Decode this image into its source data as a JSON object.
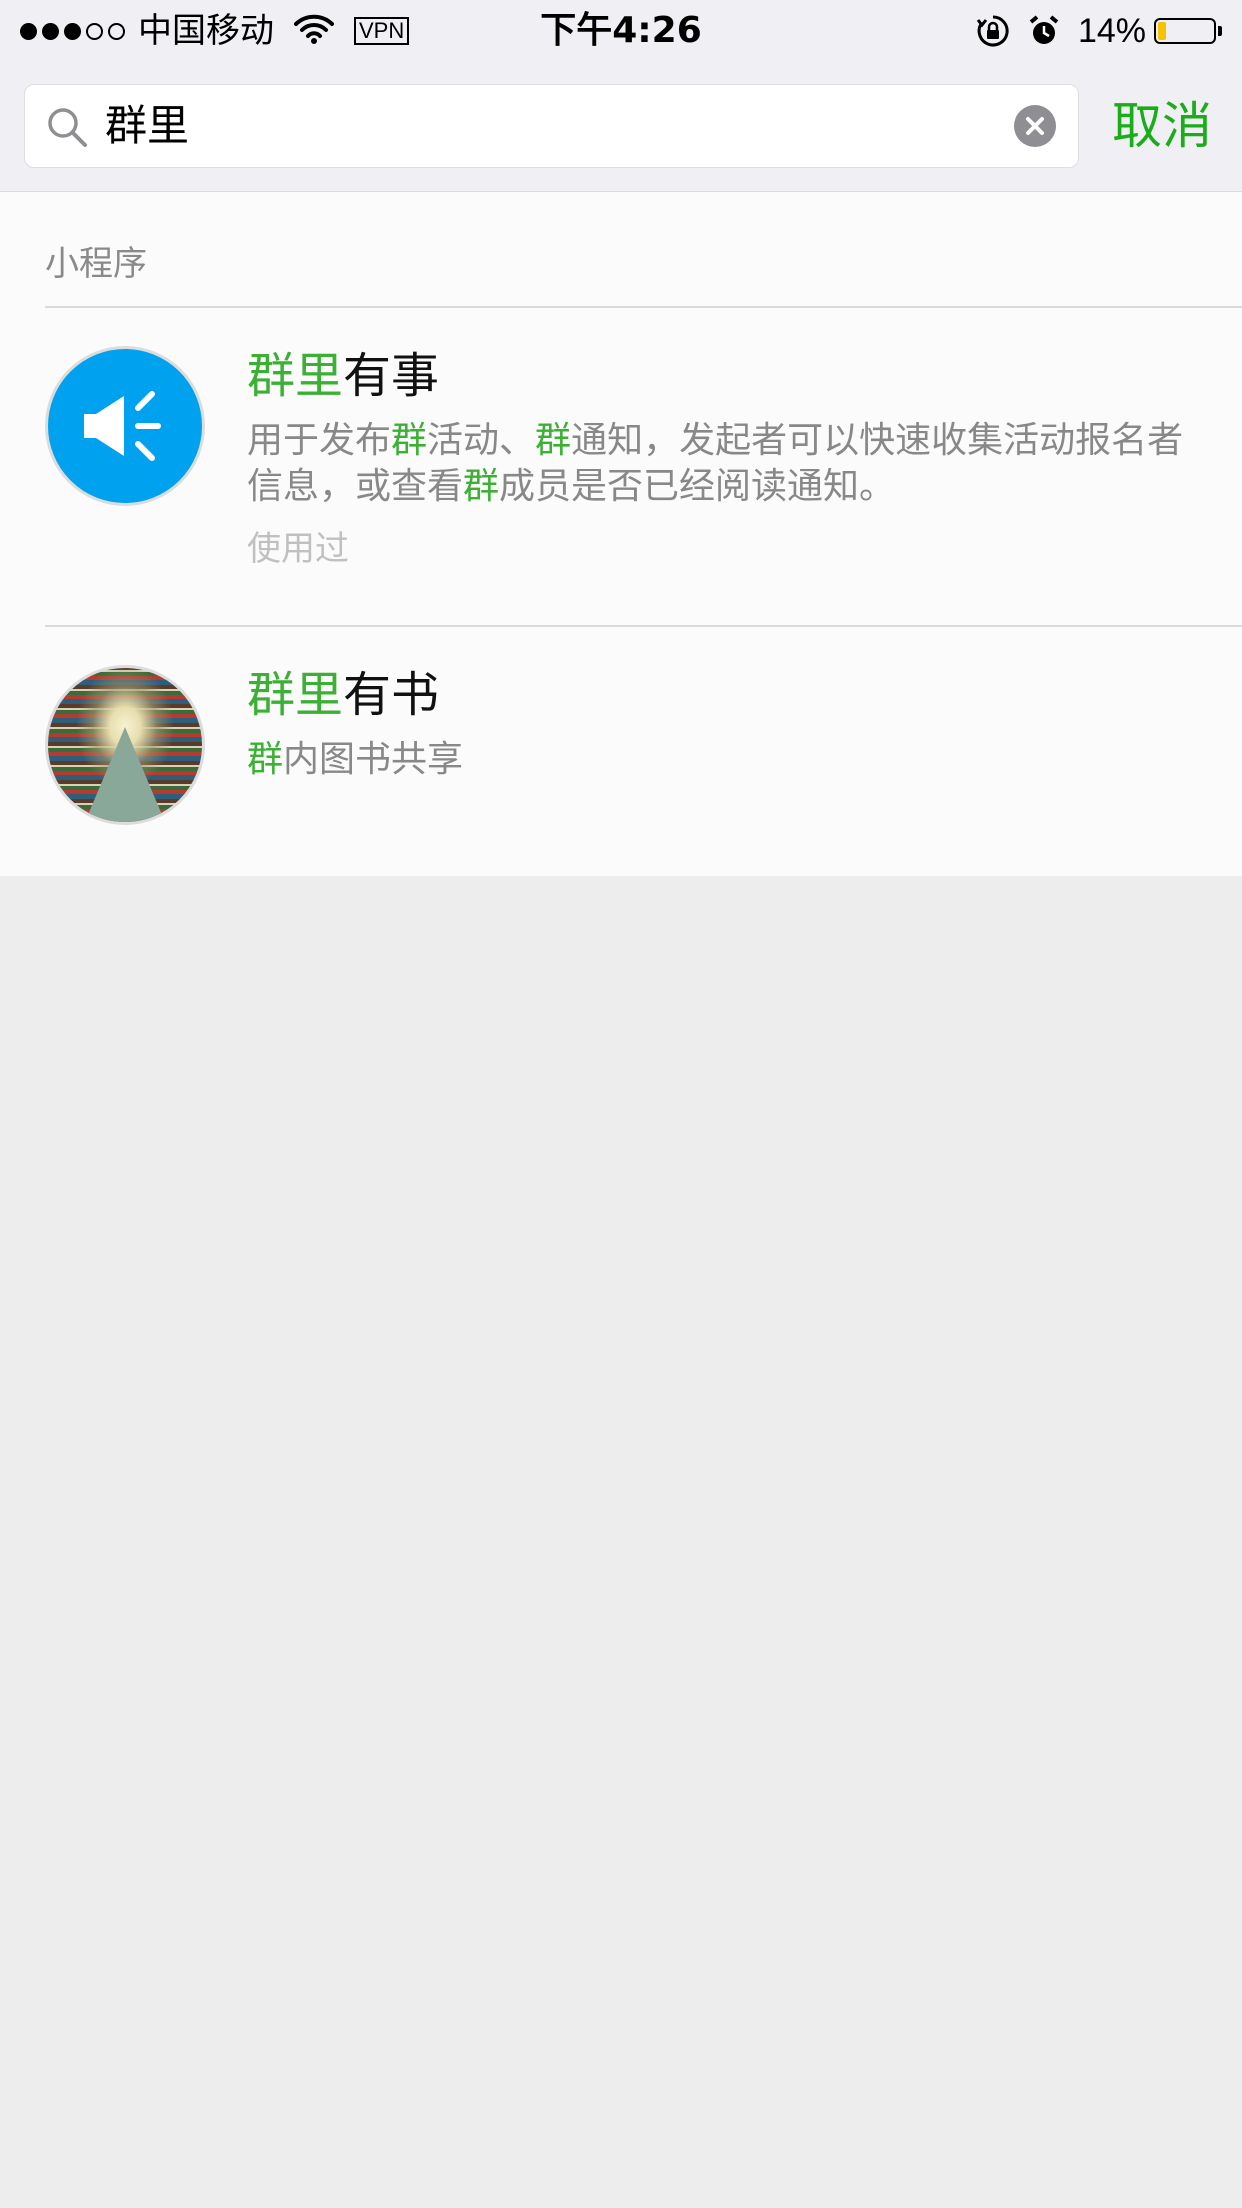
{
  "status_bar": {
    "carrier": "中国移动",
    "vpn": "VPN",
    "time": "下午4:26",
    "battery_percent_text": "14%",
    "battery_level": 0.14,
    "signal_bars_filled": 3,
    "signal_bars_total": 5
  },
  "search": {
    "query": "群里",
    "cancel_label": "取消"
  },
  "results": {
    "section_title": "小程序",
    "items": [
      {
        "title_highlight": "群里",
        "title_rest": "有事",
        "desc_line1_parts": [
          "用于发布",
          "群",
          "活动、",
          "群",
          "通知，发起者可以快速收集活动报名者"
        ],
        "desc_line2_parts": [
          "信息，或查看",
          "群",
          "成员是否已经阅读通知。"
        ],
        "meta": "使用过",
        "icon": "megaphone-icon",
        "icon_color": "#00a2f0"
      },
      {
        "title_highlight": "群里",
        "title_rest": "有书",
        "desc_parts": [
          "群",
          "内图书共享"
        ],
        "icon": "library-bookshelf-image"
      }
    ]
  },
  "colors": {
    "accent_green": "#1aad19",
    "highlight_green": "#3cb035",
    "page_background": "#ededed"
  }
}
